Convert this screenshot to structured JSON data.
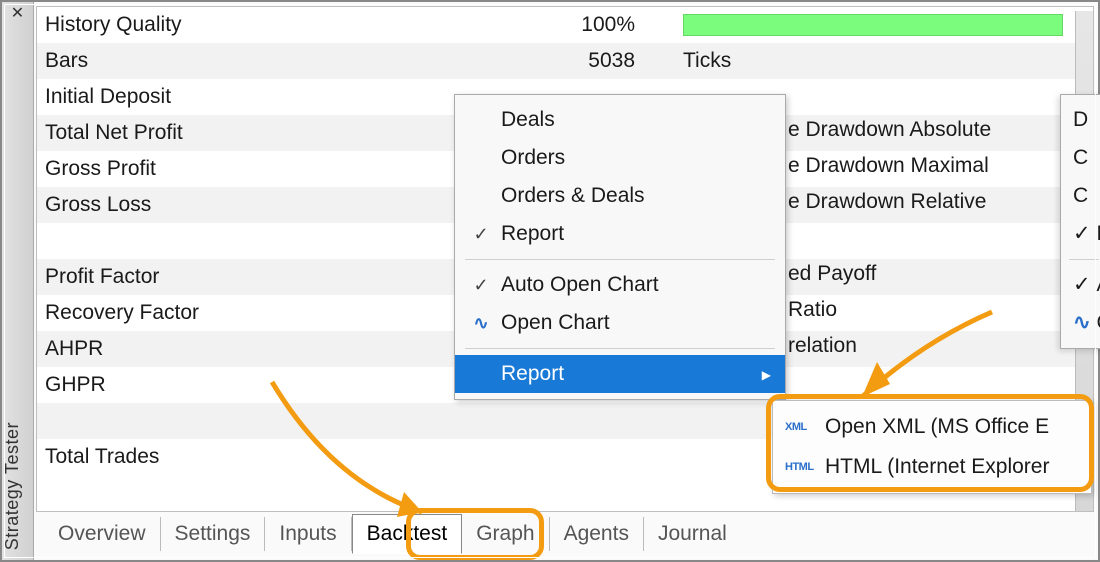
{
  "sidebar": {
    "close": "✕",
    "title": "Strategy Tester"
  },
  "rows": {
    "history_quality": {
      "label": "History Quality",
      "value": "100%"
    },
    "bars": {
      "label": "Bars",
      "value": "5038",
      "extra_label": "Ticks"
    },
    "initial_deposit": {
      "label": "Initial Deposit"
    },
    "total_net_profit": {
      "label": "Total Net Profit"
    },
    "gross_profit": {
      "label": "Gross Profit"
    },
    "gross_loss": {
      "label": "Gross Loss"
    },
    "profit_factor": {
      "label": "Profit Factor"
    },
    "recovery_factor": {
      "label": "Recovery Factor"
    },
    "ahpr": {
      "label": "AHPR"
    },
    "ghpr": {
      "label": "GHPR"
    },
    "total_trades": {
      "label": "Total Trades"
    }
  },
  "rightcol": {
    "l1": "e Drawdown Absolute",
    "l2": "e Drawdown Maximal",
    "l3": "e Drawdown Relative",
    "l4": "ed Payoff",
    "l5": " Ratio",
    "l6": "relation"
  },
  "menu": {
    "deals": "Deals",
    "orders": "Orders",
    "orders_deals": "Orders & Deals",
    "report_item": "Report",
    "auto_open_chart": "Auto Open Chart",
    "open_chart": "Open Chart",
    "report": "Report"
  },
  "menu2": {
    "i1": "D",
    "i2": "C",
    "i3": "C",
    "i4": "F",
    "i5": "A",
    "i6": "C"
  },
  "submenu": {
    "xml": "Open XML (MS Office E",
    "html": "HTML (Internet Explorer",
    "ico_xml": "XML",
    "ico_html": "HTML"
  },
  "tabs": {
    "overview": "Overview",
    "settings": "Settings",
    "inputs": "Inputs",
    "backtest": "Backtest",
    "graph": "Graph",
    "agents": "Agents",
    "journal": "Journal"
  }
}
